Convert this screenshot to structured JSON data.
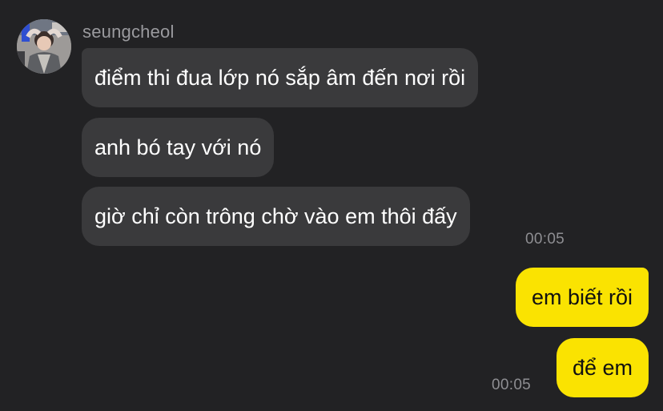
{
  "colors": {
    "background": "#222224",
    "incoming_bubble": "#3a3a3c",
    "outgoing_bubble": "#fae301",
    "timestamp": "#8e8e92"
  },
  "sender": {
    "name": "seungcheol",
    "avatar_icon": "profile-photo"
  },
  "incoming_messages": [
    {
      "text": "điểm thi đua lớp nó sắp âm đến nơi rồi"
    },
    {
      "text": "anh bó tay với nó"
    },
    {
      "text": "giờ chỉ còn trông chờ vào em thôi đấy"
    }
  ],
  "incoming_time": "00:05",
  "outgoing_messages": [
    {
      "text": "em biết rồi"
    },
    {
      "text": "để em"
    }
  ],
  "outgoing_time": "00:05"
}
